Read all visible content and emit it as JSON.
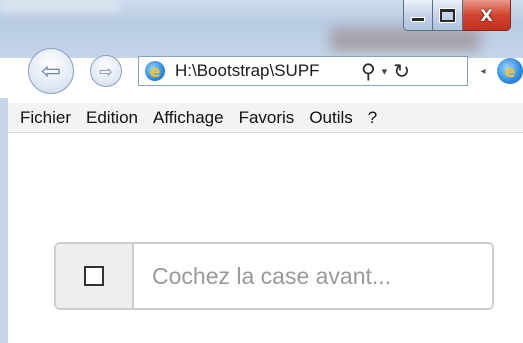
{
  "window": {
    "minimize_icon": "minimize-icon",
    "maximize_icon": "maximize-icon",
    "close_label": "X"
  },
  "nav": {
    "back_glyph": "⇦",
    "forward_glyph": "⇨",
    "address": "H:\\Bootstrap\\SUPF",
    "search_glyph": "⚲",
    "dropdown_glyph": "▾",
    "refresh_glyph": "↻",
    "tab_scroll_glyph": "◂"
  },
  "menu": {
    "items": [
      "Fichier",
      "Edition",
      "Affichage",
      "Favoris",
      "Outils",
      "?"
    ]
  },
  "form": {
    "placeholder": "Cochez la case avant..."
  },
  "colors": {
    "close_button": "#d2452f",
    "chrome_blue": "#c5d5ea",
    "placeholder_text": "#9a9a9a"
  }
}
